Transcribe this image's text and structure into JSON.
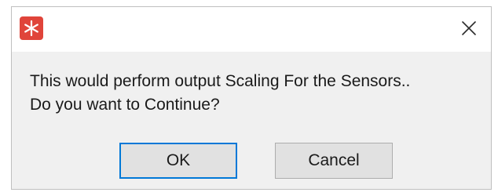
{
  "dialog": {
    "message_line1": "This would perform output Scaling For the Sensors..",
    "message_line2": "Do you want to Continue?",
    "ok_label": "OK",
    "cancel_label": "Cancel"
  },
  "colors": {
    "app_icon": "#e0443a",
    "ok_focus_border": "#0078d7",
    "dialog_bg": "#f0f0f0",
    "button_bg": "#e1e1e1"
  },
  "icons": {
    "app": "snowflake-app-icon",
    "close": "close-icon"
  }
}
